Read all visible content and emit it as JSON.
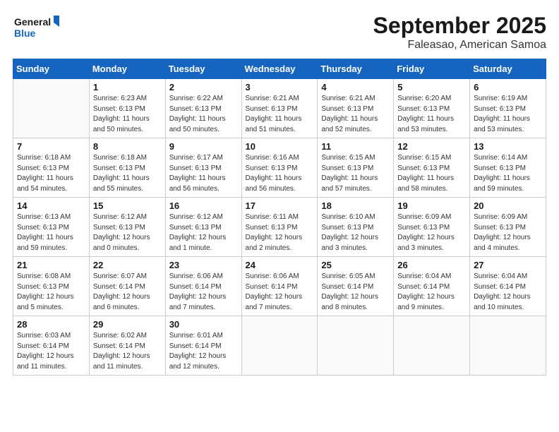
{
  "header": {
    "logo_line1": "General",
    "logo_line2": "Blue",
    "month": "September 2025",
    "location": "Faleasao, American Samoa"
  },
  "days_of_week": [
    "Sunday",
    "Monday",
    "Tuesday",
    "Wednesday",
    "Thursday",
    "Friday",
    "Saturday"
  ],
  "weeks": [
    [
      {
        "day": "",
        "info": ""
      },
      {
        "day": "1",
        "info": "Sunrise: 6:23 AM\nSunset: 6:13 PM\nDaylight: 11 hours\nand 50 minutes."
      },
      {
        "day": "2",
        "info": "Sunrise: 6:22 AM\nSunset: 6:13 PM\nDaylight: 11 hours\nand 50 minutes."
      },
      {
        "day": "3",
        "info": "Sunrise: 6:21 AM\nSunset: 6:13 PM\nDaylight: 11 hours\nand 51 minutes."
      },
      {
        "day": "4",
        "info": "Sunrise: 6:21 AM\nSunset: 6:13 PM\nDaylight: 11 hours\nand 52 minutes."
      },
      {
        "day": "5",
        "info": "Sunrise: 6:20 AM\nSunset: 6:13 PM\nDaylight: 11 hours\nand 53 minutes."
      },
      {
        "day": "6",
        "info": "Sunrise: 6:19 AM\nSunset: 6:13 PM\nDaylight: 11 hours\nand 53 minutes."
      }
    ],
    [
      {
        "day": "7",
        "info": "Sunrise: 6:18 AM\nSunset: 6:13 PM\nDaylight: 11 hours\nand 54 minutes."
      },
      {
        "day": "8",
        "info": "Sunrise: 6:18 AM\nSunset: 6:13 PM\nDaylight: 11 hours\nand 55 minutes."
      },
      {
        "day": "9",
        "info": "Sunrise: 6:17 AM\nSunset: 6:13 PM\nDaylight: 11 hours\nand 56 minutes."
      },
      {
        "day": "10",
        "info": "Sunrise: 6:16 AM\nSunset: 6:13 PM\nDaylight: 11 hours\nand 56 minutes."
      },
      {
        "day": "11",
        "info": "Sunrise: 6:15 AM\nSunset: 6:13 PM\nDaylight: 11 hours\nand 57 minutes."
      },
      {
        "day": "12",
        "info": "Sunrise: 6:15 AM\nSunset: 6:13 PM\nDaylight: 11 hours\nand 58 minutes."
      },
      {
        "day": "13",
        "info": "Sunrise: 6:14 AM\nSunset: 6:13 PM\nDaylight: 11 hours\nand 59 minutes."
      }
    ],
    [
      {
        "day": "14",
        "info": "Sunrise: 6:13 AM\nSunset: 6:13 PM\nDaylight: 11 hours\nand 59 minutes."
      },
      {
        "day": "15",
        "info": "Sunrise: 6:12 AM\nSunset: 6:13 PM\nDaylight: 12 hours\nand 0 minutes."
      },
      {
        "day": "16",
        "info": "Sunrise: 6:12 AM\nSunset: 6:13 PM\nDaylight: 12 hours\nand 1 minute."
      },
      {
        "day": "17",
        "info": "Sunrise: 6:11 AM\nSunset: 6:13 PM\nDaylight: 12 hours\nand 2 minutes."
      },
      {
        "day": "18",
        "info": "Sunrise: 6:10 AM\nSunset: 6:13 PM\nDaylight: 12 hours\nand 3 minutes."
      },
      {
        "day": "19",
        "info": "Sunrise: 6:09 AM\nSunset: 6:13 PM\nDaylight: 12 hours\nand 3 minutes."
      },
      {
        "day": "20",
        "info": "Sunrise: 6:09 AM\nSunset: 6:13 PM\nDaylight: 12 hours\nand 4 minutes."
      }
    ],
    [
      {
        "day": "21",
        "info": "Sunrise: 6:08 AM\nSunset: 6:13 PM\nDaylight: 12 hours\nand 5 minutes."
      },
      {
        "day": "22",
        "info": "Sunrise: 6:07 AM\nSunset: 6:14 PM\nDaylight: 12 hours\nand 6 minutes."
      },
      {
        "day": "23",
        "info": "Sunrise: 6:06 AM\nSunset: 6:14 PM\nDaylight: 12 hours\nand 7 minutes."
      },
      {
        "day": "24",
        "info": "Sunrise: 6:06 AM\nSunset: 6:14 PM\nDaylight: 12 hours\nand 7 minutes."
      },
      {
        "day": "25",
        "info": "Sunrise: 6:05 AM\nSunset: 6:14 PM\nDaylight: 12 hours\nand 8 minutes."
      },
      {
        "day": "26",
        "info": "Sunrise: 6:04 AM\nSunset: 6:14 PM\nDaylight: 12 hours\nand 9 minutes."
      },
      {
        "day": "27",
        "info": "Sunrise: 6:04 AM\nSunset: 6:14 PM\nDaylight: 12 hours\nand 10 minutes."
      }
    ],
    [
      {
        "day": "28",
        "info": "Sunrise: 6:03 AM\nSunset: 6:14 PM\nDaylight: 12 hours\nand 11 minutes."
      },
      {
        "day": "29",
        "info": "Sunrise: 6:02 AM\nSunset: 6:14 PM\nDaylight: 12 hours\nand 11 minutes."
      },
      {
        "day": "30",
        "info": "Sunrise: 6:01 AM\nSunset: 6:14 PM\nDaylight: 12 hours\nand 12 minutes."
      },
      {
        "day": "",
        "info": ""
      },
      {
        "day": "",
        "info": ""
      },
      {
        "day": "",
        "info": ""
      },
      {
        "day": "",
        "info": ""
      }
    ]
  ]
}
